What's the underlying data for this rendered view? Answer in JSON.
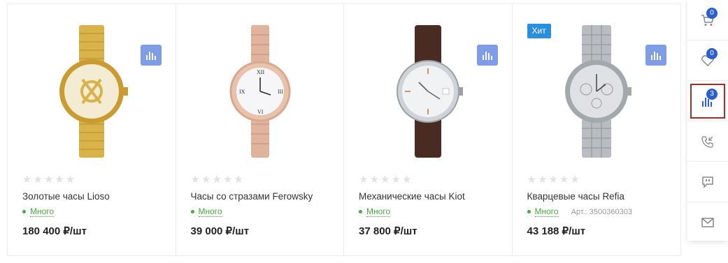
{
  "products": [
    {
      "title": "Золотые часы Lioso",
      "stock": "Много",
      "price": "180 400 ₽/шт",
      "badge": "",
      "article": ""
    },
    {
      "title": "Часы со стразами Ferowsky",
      "stock": "Много",
      "price": "39 000 ₽/шт",
      "badge": "",
      "article": ""
    },
    {
      "title": "Механические часы Kiot",
      "stock": "Много",
      "price": "37 800 ₽/шт",
      "badge": "",
      "article": ""
    },
    {
      "title": "Кварцевые часы Refia",
      "stock": "Много",
      "price": "43 188 ₽/шт",
      "badge": "Хит",
      "article": "Арт.: 3500360303"
    }
  ],
  "side": {
    "cart_count": "0",
    "favorites_count": "0",
    "compare_count": "3"
  },
  "colors": {
    "accent": "#2b5fce",
    "compare_button": "#7e9de6",
    "in_stock": "#4aa843",
    "hit_badge": "#2b8fde",
    "active_outline": "#a52a2a"
  }
}
